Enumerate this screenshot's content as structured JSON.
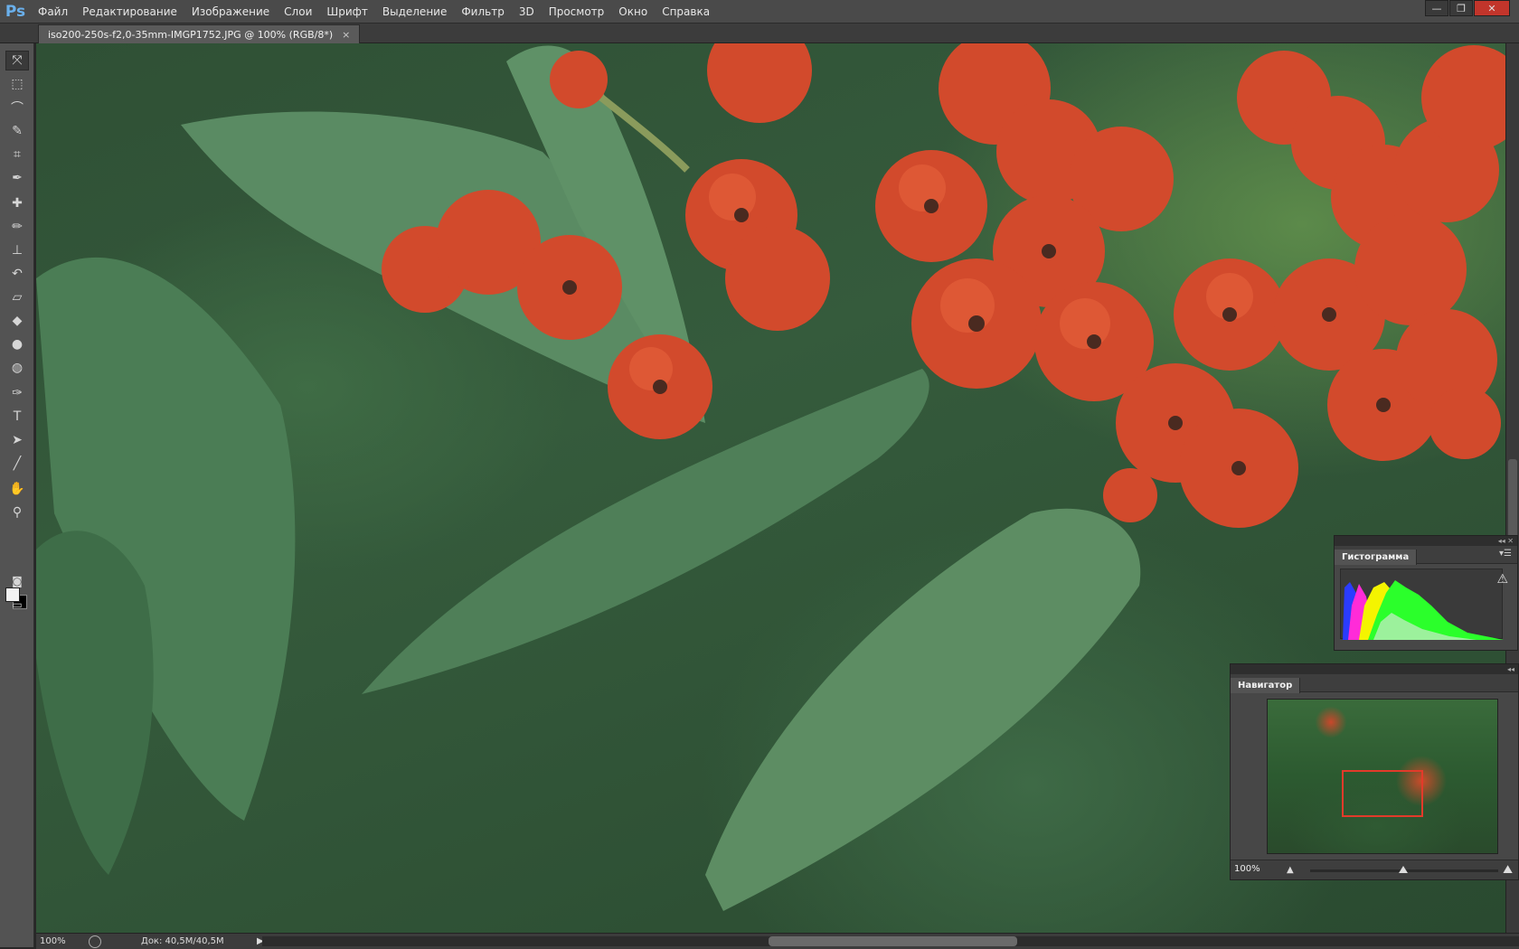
{
  "app": {
    "logo": "Ps"
  },
  "menu": [
    "Файл",
    "Редактирование",
    "Изображение",
    "Слои",
    "Шрифт",
    "Выделение",
    "Фильтр",
    "3D",
    "Просмотр",
    "Окно",
    "Справка"
  ],
  "window_controls": {
    "minimize": "—",
    "restore": "❐",
    "close": "✕"
  },
  "document_tab": {
    "title": "iso200-250s-f2,0-35mm-IMGP1752.JPG @ 100% (RGB/8*)",
    "close": "×"
  },
  "tools": {
    "move": "⤧",
    "marquee": "⬚",
    "lasso": "⌒",
    "quick_select": "✎",
    "crop": "⌗",
    "eyedropper": "✒",
    "healing": "✚",
    "brush": "✏",
    "stamp": "⊥",
    "history_brush": "↶",
    "eraser": "▱",
    "bucket": "◆",
    "blur": "●",
    "dodge": "◍",
    "pen": "✑",
    "type": "T",
    "path_select": "➤",
    "line": "╱",
    "hand": "✋",
    "zoom": "⚲",
    "quick_mask": "◙",
    "screen_mode": "▭"
  },
  "status": {
    "zoom": "100%",
    "doc": "Док: 40,5M/40,5M",
    "arrow": "▶"
  },
  "histogram_panel": {
    "tab": "Гистограмма",
    "warning": "⚠",
    "menu": "▾☰"
  },
  "navigator_panel": {
    "tab": "Навигатор",
    "zoom": "100%",
    "small": "▲",
    "big": "⛰"
  },
  "colors": {
    "foreground": "#f2f2f2",
    "background": "#000000",
    "nav_view_box": "#e33a2a"
  }
}
